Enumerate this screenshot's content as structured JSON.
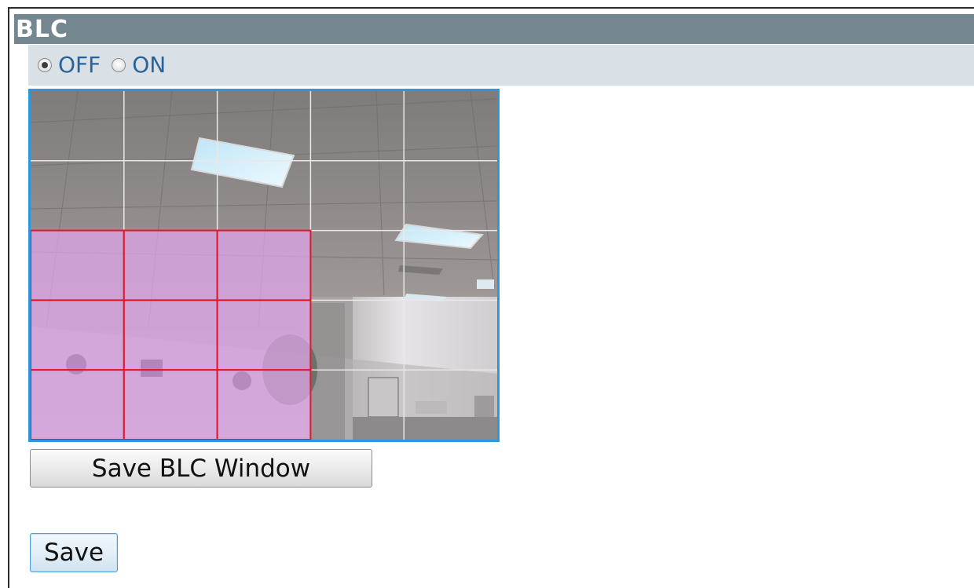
{
  "section": {
    "title": "BLC"
  },
  "blc_mode": {
    "options": [
      {
        "label": "OFF",
        "checked": true
      },
      {
        "label": "ON",
        "checked": false
      }
    ]
  },
  "blc_window": {
    "grid_columns": 5,
    "grid_rows": 5,
    "selected_cells": [
      [
        0,
        2
      ],
      [
        1,
        2
      ],
      [
        2,
        2
      ],
      [
        0,
        3
      ],
      [
        1,
        3
      ],
      [
        2,
        3
      ],
      [
        0,
        4
      ],
      [
        1,
        4
      ],
      [
        2,
        4
      ]
    ],
    "selection_color": "#e2162b",
    "highlight_color": "#e1a5ec",
    "grid_color": "#e8e8e8",
    "border_color": "#2f95dd"
  },
  "buttons": {
    "save_blc_window": "Save BLC Window",
    "save": "Save"
  }
}
